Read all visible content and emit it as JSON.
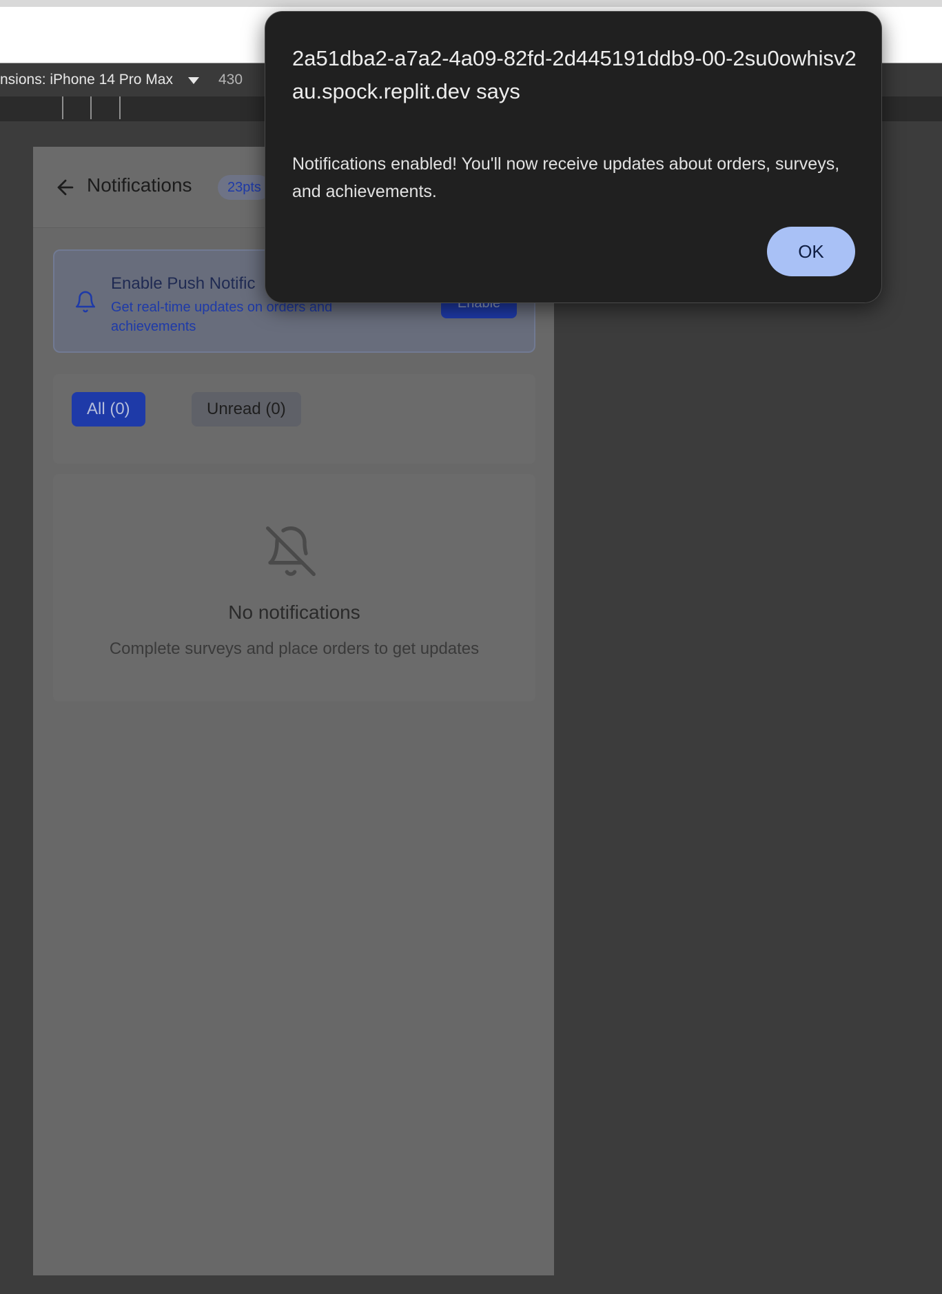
{
  "devtools": {
    "device_label": "nsions: iPhone 14 Pro Max",
    "width_value": "430"
  },
  "app": {
    "page_title": "Notifications",
    "points_badge": "23pts",
    "push_card": {
      "title": "Enable Push Notific",
      "description": "Get real-time updates on orders and achievements",
      "enable_label": "Enable"
    },
    "tabs": [
      {
        "label": "All (0)",
        "active": true
      },
      {
        "label": "Unread (0)",
        "active": false
      }
    ],
    "empty_state": {
      "title": "No notifications",
      "description": "Complete surveys and place orders to get updates"
    }
  },
  "dialog": {
    "title": "2a51dba2-a7a2-4a09-82fd-2d445191ddb9-00-2su0owhisv2au.spock.replit.dev says",
    "message": "Notifications enabled! You'll now receive updates about orders, surveys, and achievements.",
    "ok_label": "OK"
  },
  "colors": {
    "accent": "#1e3aa8",
    "ok_button": "#a9c1f6",
    "dialog_bg": "#202020"
  }
}
